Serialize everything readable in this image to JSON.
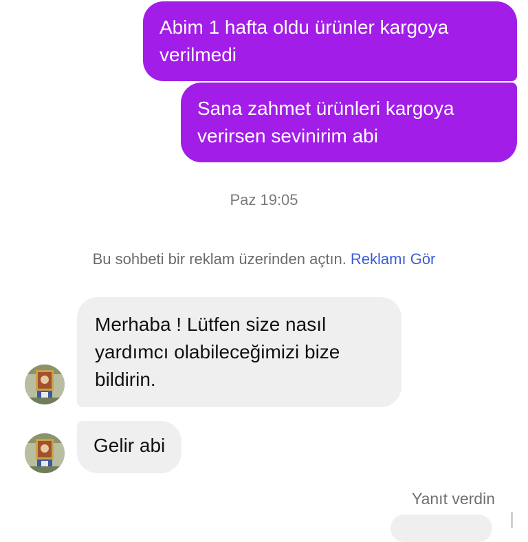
{
  "thread": {
    "outgoing": [
      {
        "text": "Abim 1 hafta oldu ürünler kargoya verilmedi"
      },
      {
        "text": "Sana zahmet ürünleri kargoya verirsen sevinirim abi"
      }
    ],
    "timestamp": "Paz 19:05",
    "ad_notice": {
      "text": "Bu sohbeti bir reklam üzerinden açtın.",
      "link": "Reklamı Gör"
    },
    "incoming": [
      {
        "text": "Merhaba ! Lütfen size nasıl yardımcı olabileceğimizi bize bildirin."
      },
      {
        "text": "Gelir abi"
      }
    ],
    "status": "Yanıt verdin"
  },
  "colors": {
    "outgoing_bubble": "#a21de8",
    "incoming_bubble": "#efefef",
    "link": "#3b5bd8"
  },
  "icons": {
    "avatar": "profile-avatar-icon"
  }
}
